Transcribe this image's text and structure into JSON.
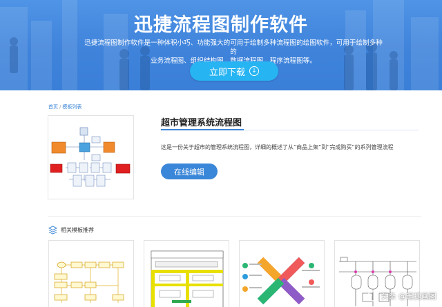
{
  "hero": {
    "title": "迅捷流程图制作软件",
    "description_line1": "迅捷流程图制作软件是一种体积小巧、功能强大的可用于绘制多种流程图的绘图软件，可用于绘制多种的",
    "description_line2": "业务流程图、组织结构图、数据流程图、程序流程图等。",
    "download_label": "立即下载",
    "download_icon": "arrow-down-circle-icon",
    "bg_color": "#3f83db",
    "button_color": "#27b4f2"
  },
  "breadcrumb": {
    "home": "首页",
    "separator": "/",
    "current": "模板列表"
  },
  "template": {
    "title": "超市管理系统流程图",
    "description": "这是一份关于超市的管理系统流程图，详细的概述了从“商品上架”到“完成购买”的系列管理流程",
    "edit_label": "在线编辑",
    "accent_color": "#3a86d8"
  },
  "related": {
    "heading": "相关模板推荐",
    "icon": "layers-icon"
  },
  "watermark": {
    "text": "头条 @迅捷画图"
  }
}
